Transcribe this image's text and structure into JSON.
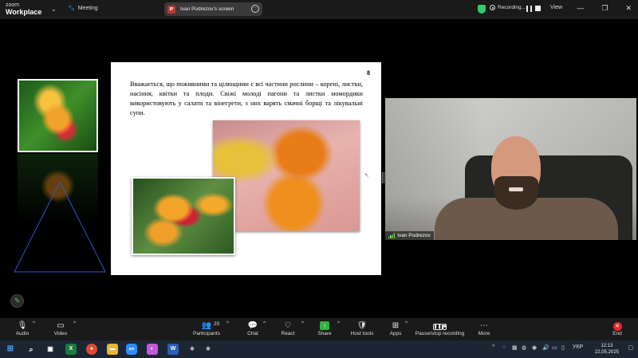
{
  "topbar": {
    "brand_line1": "zoom",
    "brand_line2": "Workplace",
    "meeting_label": "Meeting",
    "share_initials": "IP",
    "share_label": "Ivan Podrezov's screen",
    "recording_label": "Recording...",
    "view_label": "View"
  },
  "slide": {
    "page_number": "8",
    "text": "Вважається, що поживними та цілющими є всі частини рослини – корені, листки, насіння, квітки та плоди. Свіжі молоді пагони та листки момордики використовують у салати та вінегрети, з них варять смачні борщі та лікувальні супи."
  },
  "video": {
    "participant_name": "Ivan Podrezov"
  },
  "toolbar": {
    "audio": "Audio",
    "video": "Video",
    "participants": "Participants",
    "participants_count": "20",
    "chat": "Chat",
    "react": "React",
    "share": "Share",
    "host_tools": "Host tools",
    "apps": "Apps",
    "recording": "Pause/stop recording",
    "more": "More",
    "end": "End"
  },
  "taskbar": {
    "language": "УКР",
    "time": "12:13",
    "date": "22.05.2025"
  },
  "colors": {
    "toolbar_bg": "#1a1a1a",
    "taskbar_bg": "#1c2632",
    "share_green": "#2fb344",
    "end_red": "#e02828",
    "shield_green": "#2ecc71"
  }
}
